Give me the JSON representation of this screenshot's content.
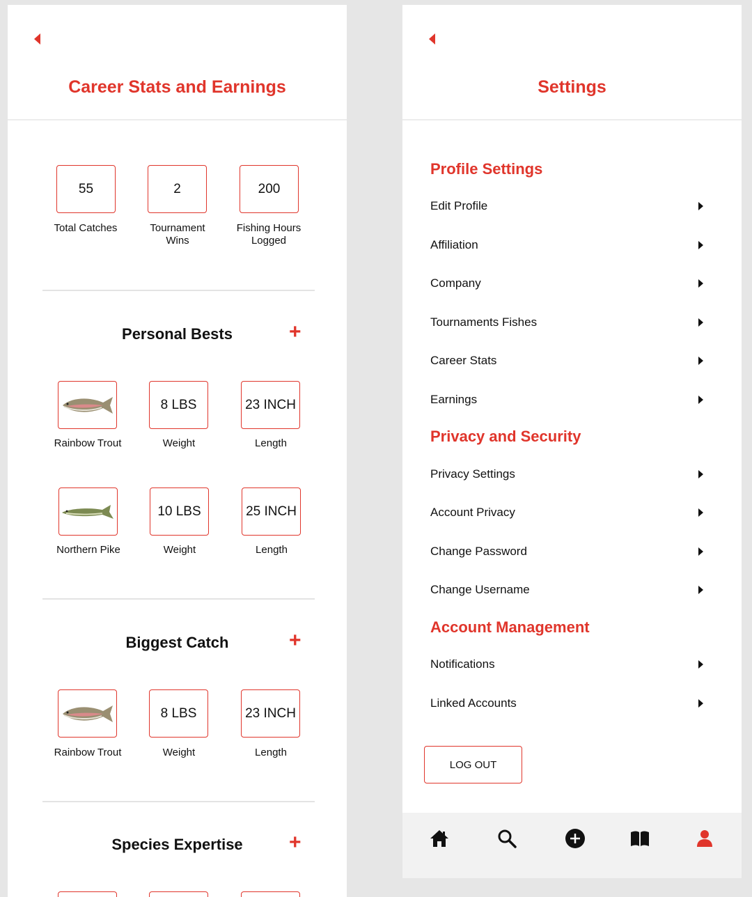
{
  "left": {
    "title": "Career Stats and Earnings",
    "stats": [
      {
        "value": "55",
        "label": "Total Catches"
      },
      {
        "value": "2",
        "label": "Tournament Wins"
      },
      {
        "value": "200",
        "label": "Fishing Hours Logged"
      }
    ],
    "personal_bests": {
      "title": "Personal Bests",
      "rows": [
        {
          "species": "Rainbow Trout",
          "weight": "8 LBS",
          "weight_label": "Weight",
          "length": "23 INCH",
          "length_label": "Length"
        },
        {
          "species": "Northern Pike",
          "weight": "10 LBS",
          "weight_label": "Weight",
          "length": "25 INCH",
          "length_label": "Length"
        }
      ]
    },
    "biggest_catch": {
      "title": "Biggest Catch",
      "row": {
        "species": "Rainbow Trout",
        "weight": "8 LBS",
        "weight_label": "Weight",
        "length": "23 INCH",
        "length_label": "Length"
      }
    },
    "species_expertise": {
      "title": "Species Expertise"
    },
    "icons": {
      "back": "back-arrow-icon",
      "add": "plus-icon"
    }
  },
  "right": {
    "title": "Settings",
    "groups": [
      {
        "title": "Profile Settings",
        "items": [
          "Edit Profile",
          "Affiliation",
          "Company",
          "Tournaments Fishes",
          "Career Stats",
          "Earnings"
        ]
      },
      {
        "title": "Privacy and Security",
        "items": [
          "Privacy Settings",
          "Account Privacy",
          "Change Password",
          "Change Username"
        ]
      },
      {
        "title": "Account Management",
        "items": [
          "Notifications",
          "Linked Accounts"
        ]
      }
    ],
    "logout": "LOG OUT",
    "nav": [
      "home-icon",
      "search-icon",
      "add-circle-icon",
      "book-icon",
      "profile-icon"
    ],
    "active_nav": "profile-icon"
  },
  "colors": {
    "accent": "#e0352b",
    "text": "#111111",
    "background": "#e6e6e6",
    "navbar": "#f2f2f2"
  }
}
